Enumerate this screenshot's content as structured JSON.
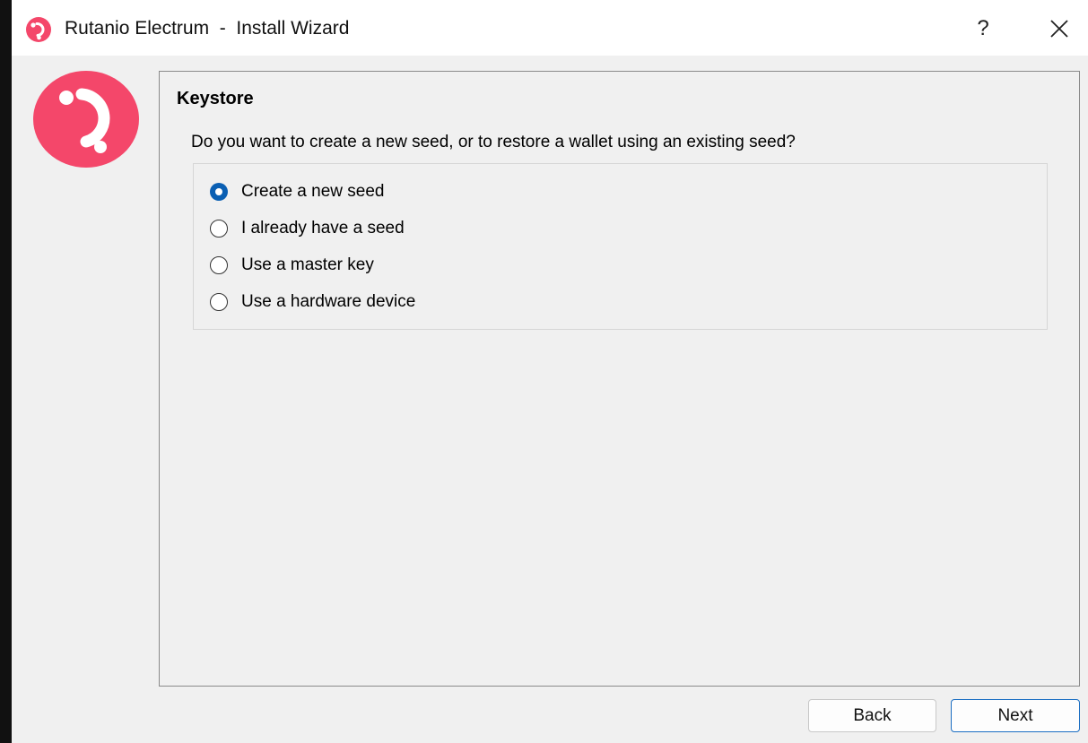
{
  "window": {
    "title": "Rutanio Electrum  -  Install Wizard",
    "help_label": "?",
    "accent_color": "#f4476a"
  },
  "page": {
    "title": "Keystore",
    "question": "Do you want to create a new seed, or to restore a wallet using an existing seed?",
    "options": [
      {
        "label": "Create a new seed",
        "checked": true
      },
      {
        "label": "I already have a seed",
        "checked": false
      },
      {
        "label": "Use a master key",
        "checked": false
      },
      {
        "label": "Use a hardware device",
        "checked": false
      }
    ]
  },
  "buttons": {
    "back_label": "Back",
    "next_label": "Next"
  }
}
